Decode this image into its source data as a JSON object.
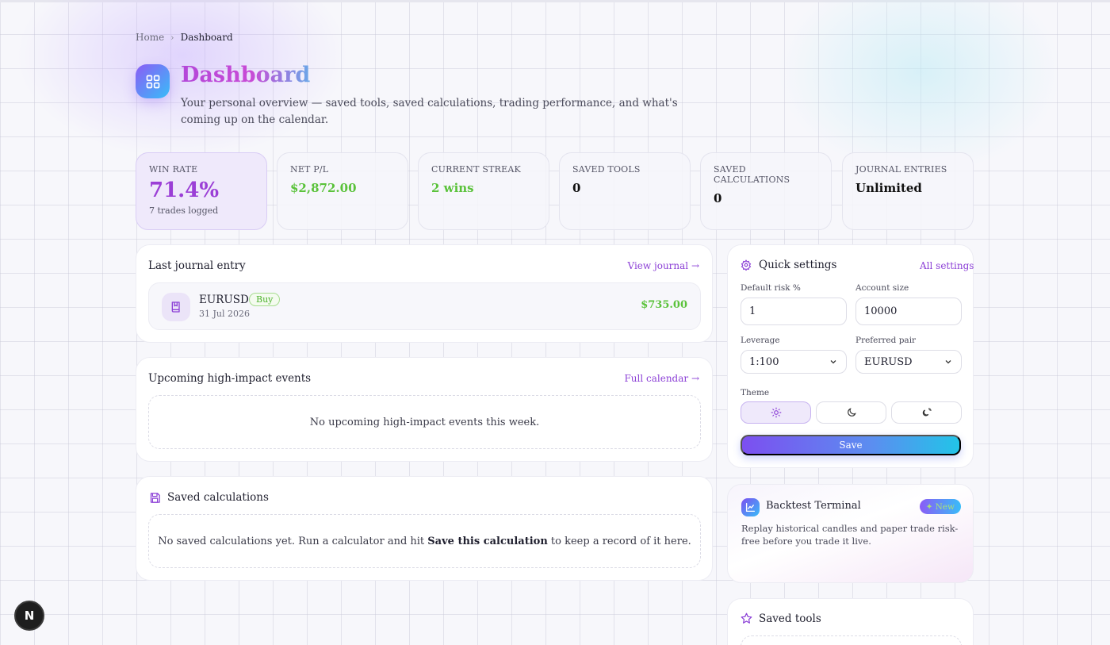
{
  "breadcrumb": {
    "home": "Home",
    "separator": "›",
    "current": "Dashboard"
  },
  "header": {
    "icon": "dashboard-grid-icon",
    "title": "Dashboard",
    "subtitle": "Your personal overview — saved tools, saved calculations, trading performance, and what's coming up on the calendar."
  },
  "stats": [
    {
      "label": "WIN RATE",
      "value": "71.4%",
      "sub": "7 trades logged"
    },
    {
      "label": "NET P/L",
      "value": "$2,872.00"
    },
    {
      "label": "CURRENT STREAK",
      "value": "2 wins"
    },
    {
      "label": "SAVED TOOLS",
      "value": "0"
    },
    {
      "label": "SAVED CALCULATIONS",
      "value": "0"
    },
    {
      "label": "JOURNAL ENTRIES",
      "value": "Unlimited"
    }
  ],
  "last_entry": {
    "title": "Last journal entry",
    "link": "View journal →",
    "icon": "book-icon",
    "pair": "EURUSD",
    "side": "Buy",
    "date": "31 Jul 2026",
    "amount": "$735.00"
  },
  "events": {
    "title": "Upcoming high-impact events",
    "link": "Full calendar →",
    "empty": "No upcoming high-impact events this week."
  },
  "saved_calcs": {
    "title": "Saved calculations",
    "icon": "save-disk-icon",
    "empty_before": "No saved calculations yet. Run a calculator and hit ",
    "empty_bold": "Save this calculation",
    "empty_after": " to keep a record of it here."
  },
  "quick_settings": {
    "title": "Quick settings",
    "icon": "gear-icon",
    "link": "All settings",
    "risk_label": "Default risk %",
    "risk_value": "1",
    "account_label": "Account size",
    "account_value": "10000",
    "leverage_label": "Leverage",
    "leverage_value": "1:100",
    "pair_label": "Preferred pair",
    "pair_value": "EURUSD",
    "theme_label": "Theme",
    "theme_options": [
      "sun-icon",
      "moon-icon",
      "system-theme-icon"
    ],
    "theme_selected": "sun-icon",
    "save_label": "Save"
  },
  "backtest": {
    "title": "Backtest Terminal",
    "icon": "chart-line-icon",
    "badge": "New",
    "description": "Replay historical candles and paper trade risk-free before you trade it live."
  },
  "saved_tools": {
    "title": "Saved tools",
    "icon": "star-icon"
  },
  "dev_badge": {
    "label": "N"
  },
  "colors": {
    "accent": "#8b5cf6",
    "positive": "#5ac23a",
    "title_gradient_start": "#b347d9",
    "title_gradient_end": "#6aa8e8"
  }
}
